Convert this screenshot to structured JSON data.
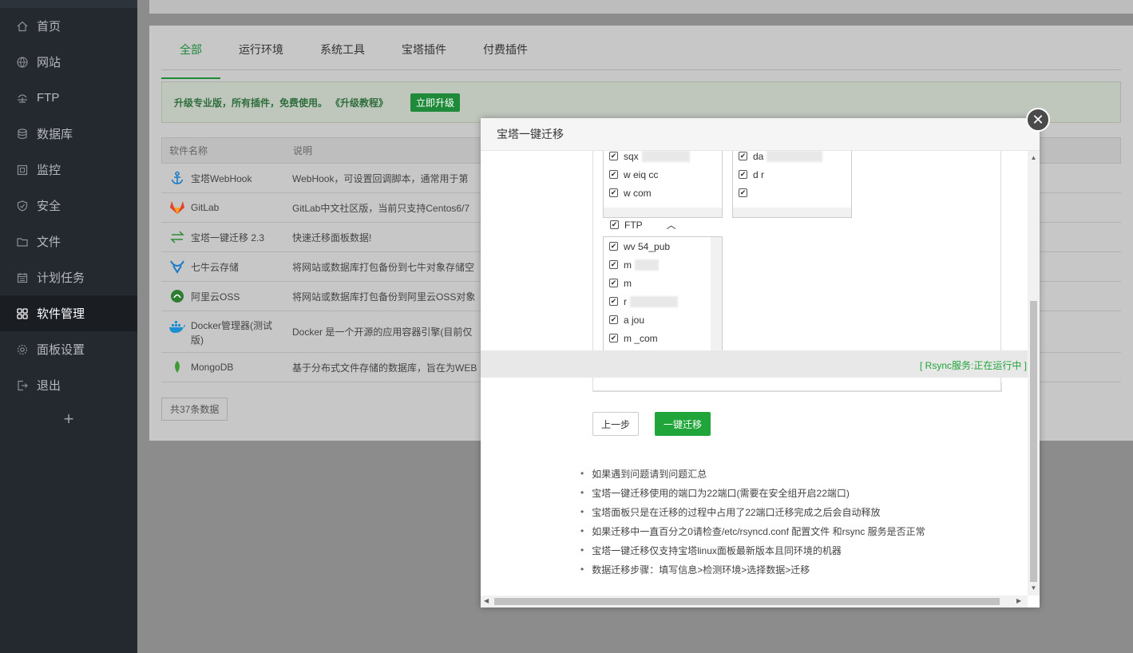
{
  "sidebar": {
    "items": [
      {
        "label": "首页",
        "icon": "home-icon"
      },
      {
        "label": "网站",
        "icon": "globe-icon"
      },
      {
        "label": "FTP",
        "icon": "ftp-icon"
      },
      {
        "label": "数据库",
        "icon": "database-icon"
      },
      {
        "label": "监控",
        "icon": "monitor-icon"
      },
      {
        "label": "安全",
        "icon": "shield-icon"
      },
      {
        "label": "文件",
        "icon": "folder-icon"
      },
      {
        "label": "计划任务",
        "icon": "calendar-icon"
      },
      {
        "label": "软件管理",
        "icon": "grid-icon"
      },
      {
        "label": "面板设置",
        "icon": "gear-icon"
      },
      {
        "label": "退出",
        "icon": "logout-icon"
      }
    ],
    "add": "+"
  },
  "main": {
    "tabs": [
      "全部",
      "运行环境",
      "系统工具",
      "宝塔插件",
      "付费插件"
    ],
    "notice": {
      "text": "升级专业版，所有插件，免费使用。",
      "link": "《升级教程》",
      "button": "立即升级"
    },
    "table": {
      "headers": [
        "软件名称",
        "说明"
      ],
      "rows": [
        {
          "name": "宝塔WebHook",
          "desc": "WebHook，可设置回调脚本，通常用于第"
        },
        {
          "name": "GitLab",
          "desc": "GitLab中文社区版，当前只支持Centos6/7"
        },
        {
          "name": "宝塔一键迁移 2.3",
          "desc": "快速迁移面板数据!"
        },
        {
          "name": "七牛云存储",
          "desc": "将网站或数据库打包备份到七牛对象存储空"
        },
        {
          "name": "阿里云OSS",
          "desc": "将网站或数据库打包备份到阿里云OSS对象"
        },
        {
          "name": "Docker管理器(测试版)",
          "desc": "Docker 是一个开源的应用容器引擎(目前仅"
        },
        {
          "name": "MongoDB",
          "desc": "基于分布式文件存储的数据库，旨在为WEB"
        }
      ]
    },
    "total": "共37条数据"
  },
  "modal": {
    "title": "宝塔一键迁移",
    "close": "✕",
    "site_list": [
      {
        "text": "sqx",
        "checked": "✔"
      },
      {
        "text": "w    eiq       cc",
        "checked": "✔"
      },
      {
        "text": "w                com",
        "checked": "✔"
      }
    ],
    "db_list": [
      {
        "text": "da",
        "checked": "✔"
      },
      {
        "text": "d    r",
        "checked": "✔"
      },
      {
        "text": "",
        "checked": "✔"
      }
    ],
    "ftp_label": "FTP",
    "ftp_checked": "✔",
    "ftp_list": [
      {
        "text": "wv       54_pub",
        "checked": "✔"
      },
      {
        "text": "m",
        "checked": "✔"
      },
      {
        "text": "             m",
        "checked": "✔"
      },
      {
        "text": "       r",
        "checked": "✔"
      },
      {
        "text": "a               jou",
        "checked": "✔"
      },
      {
        "text": "m                 _com",
        "checked": "✔"
      }
    ],
    "rsync_status": "[ Rsync服务:正在运行中 ]",
    "prev_button": "上一步",
    "go_button": "一键迁移",
    "tips": [
      "如果遇到问题请到问题汇总",
      "宝塔一键迁移使用的端口为22端口(需要在安全组开启22端口)",
      "宝塔面板只是在迁移的过程中占用了22端口迁移完成之后会自动释放",
      "如果迁移中一直百分之0请检查/etc/rsyncd.conf 配置文件 和rsync 服务是否正常",
      "宝塔一键迁移仅支持宝塔linux面板最新版本且同环境的机器",
      "数据迁移步骤：填写信息>检测环境>选择数据>迁移"
    ]
  },
  "colors": {
    "accent": "#20a53a",
    "sidebar_bg": "#24292f",
    "overlay": "#8c8c8c"
  }
}
